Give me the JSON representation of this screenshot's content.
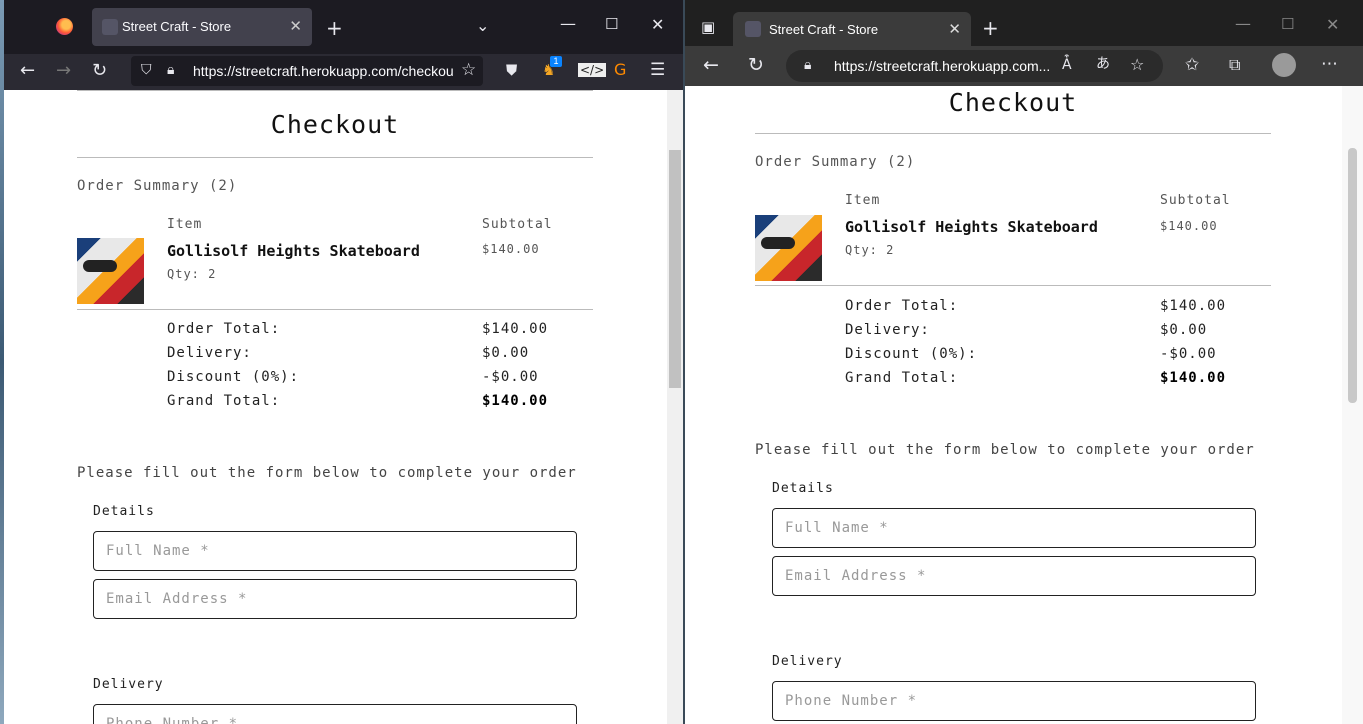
{
  "firefox": {
    "tab_title": "Street Craft - Store",
    "url": "https://streetcraft.herokuapp.com/checkout",
    "badge_count": "1"
  },
  "edge": {
    "tab_title": "Street Craft - Store",
    "url": "https://streetcraft.herokuapp.com..."
  },
  "page": {
    "title": "Checkout",
    "order_summary": "Order Summary (2)",
    "col_item": "Item",
    "col_subtotal": "Subtotal",
    "product": {
      "name": "Gollisolf Heights Skateboard",
      "qty": "Qty: 2",
      "subtotal": "$140.00"
    },
    "totals": [
      {
        "label": "Order Total:",
        "value": "$140.00"
      },
      {
        "label": "Delivery:",
        "value": "$0.00"
      },
      {
        "label": "Discount (0%):",
        "value": "-$0.00"
      },
      {
        "label": "Grand Total:",
        "value": "$140.00"
      }
    ],
    "prompt": "Please fill out the form below to complete your order",
    "details_label": "Details",
    "full_name_placeholder": "Full Name *",
    "email_placeholder": "Email Address *",
    "delivery_label": "Delivery",
    "phone_placeholder": "Phone Number *"
  }
}
